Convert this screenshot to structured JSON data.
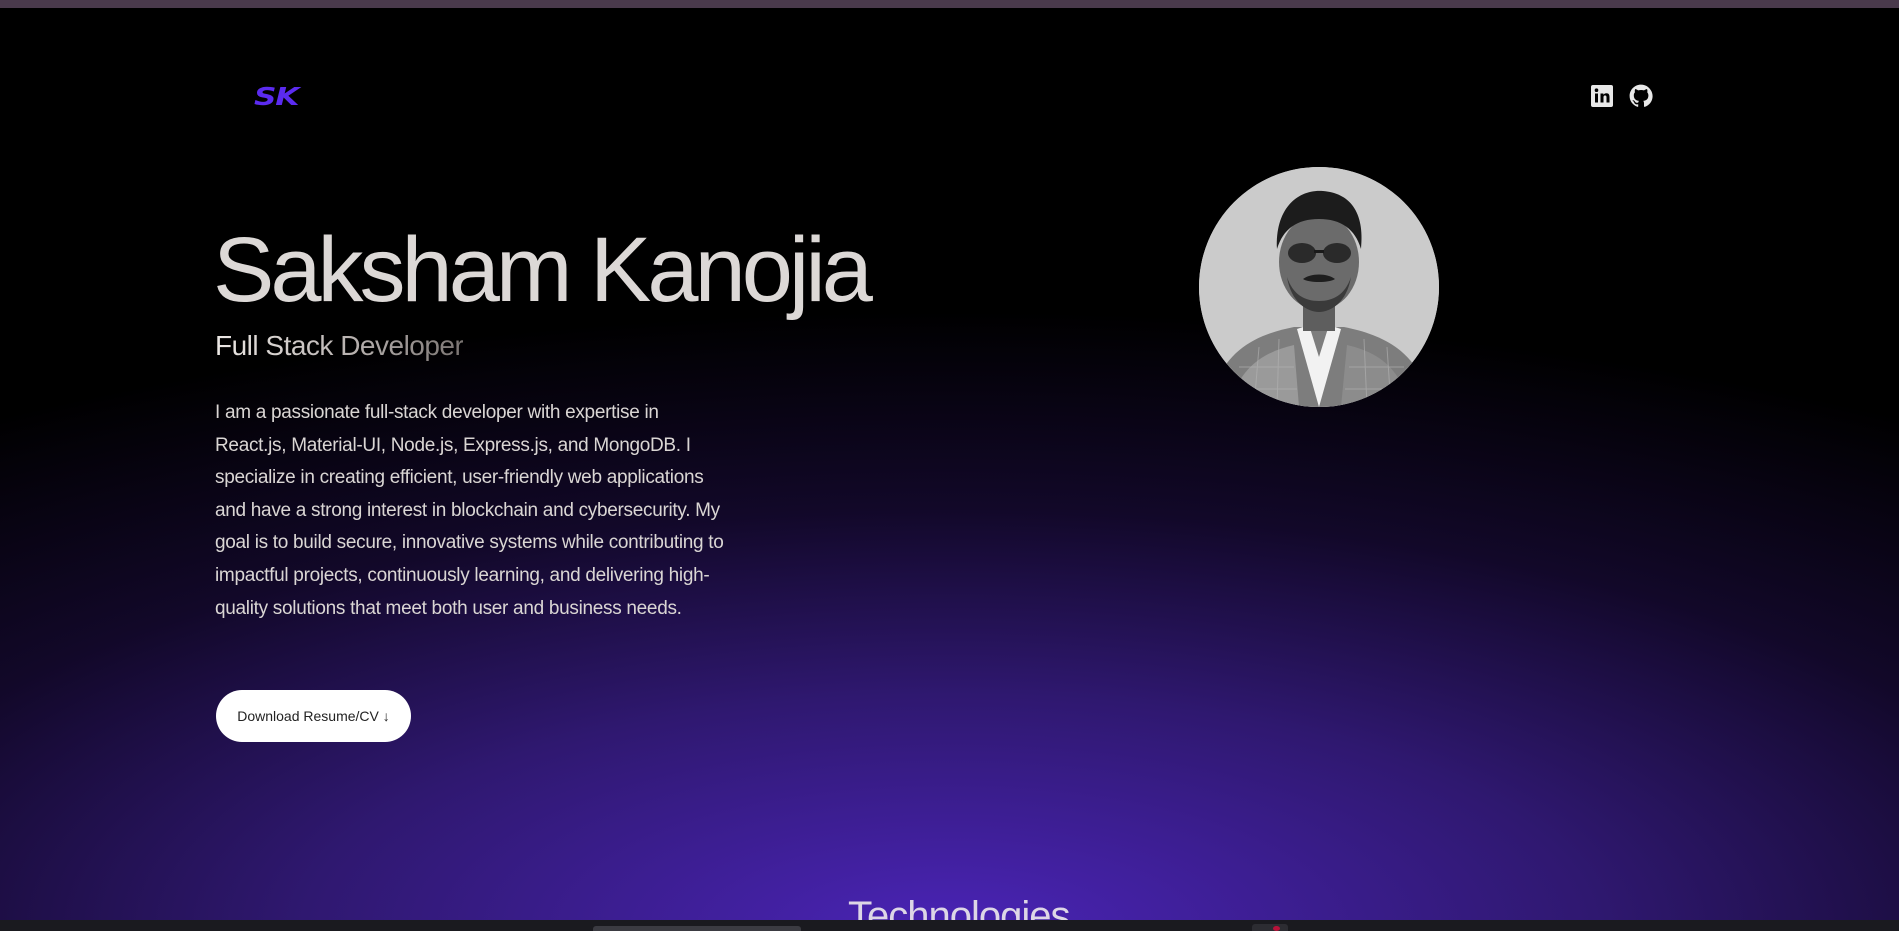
{
  "header": {
    "logo_text": "SK",
    "logo_color": "#5b2bf0",
    "social_links": [
      {
        "icon": "linkedin-icon"
      },
      {
        "icon": "github-icon"
      }
    ]
  },
  "hero": {
    "name": "Saksham Kanojia",
    "role": "Full Stack Developer",
    "bio": "I am a passionate full-stack developer with expertise in React.js, Material-UI, Node.js, Express.js, and MongoDB. I specialize in creating efficient, user-friendly web applications and have a strong interest in blockchain and cybersecurity. My goal is to build secure, innovative systems while contributing to impactful projects, continuously learning, and delivering high-quality solutions that meet both user and business needs.",
    "download_button_label": "Download Resume/CV ↓",
    "avatar_icon": "profile-photo"
  },
  "next_section": {
    "heading": "Technologies"
  },
  "theme": {
    "background": "#000000",
    "gradient_accent": "#4a24b6",
    "text_primary": "#dcd8d6"
  }
}
